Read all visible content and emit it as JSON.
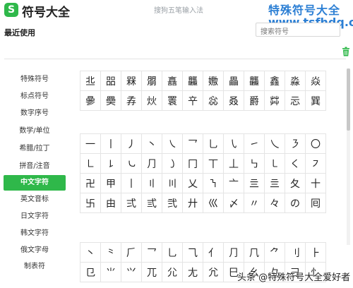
{
  "app": {
    "title": "符号大全",
    "ime_hint": "搜狗五笔输入法",
    "watermark_top": "特殊符号大全",
    "watermark_url": "www.tsfhdq.cn",
    "watermark_bottom": "头条 @特殊符号大全爱好者"
  },
  "recent": {
    "label": "最近使用"
  },
  "search": {
    "placeholder": "搜索符号"
  },
  "sidebar": {
    "items": [
      {
        "label": "特殊符号"
      },
      {
        "label": "标点符号"
      },
      {
        "label": "数字序号"
      },
      {
        "label": "数学/单位"
      },
      {
        "label": "希腊/拉丁"
      },
      {
        "label": "拼音/注音"
      },
      {
        "label": "中文字符"
      },
      {
        "label": "英文音标"
      },
      {
        "label": "日文字符"
      },
      {
        "label": "韩文字符"
      },
      {
        "label": "俄文字母"
      },
      {
        "label": "制表符"
      }
    ],
    "active_index": 6
  },
  "colors": {
    "accent": "#2fb84a",
    "watermark": "#2c7fd4"
  },
  "grid1": [
    [
      "丠",
      "㗊",
      "槑",
      "朤",
      "譶",
      "龘",
      "嫐",
      "畾",
      "龘",
      "鑫",
      "淼",
      "焱"
    ],
    [
      "曑",
      "奰",
      "孨",
      "炏",
      "瞏",
      "䇂",
      "惢",
      "叒",
      "爵",
      "茻",
      "忈",
      "巽"
    ]
  ],
  "grid2": [
    [
      "一",
      "丨",
      "丿",
      "丶",
      "㇏",
      "乛",
      "乚",
      "㇂",
      "㇀",
      "乀",
      "㇋",
      "〇"
    ],
    [
      "㇗",
      "㇙",
      "㇃",
      "⺆",
      "㇁",
      "冂",
      "丅",
      "丄",
      "㇉",
      "㇄",
      "く",
      "㇇"
    ],
    [
      "卍",
      "甲",
      "丨",
      "〢",
      "〣",
      "乂",
      "㇎",
      "亠",
      "亖",
      "亖",
      "夂",
      "十"
    ],
    [
      "卐",
      "由",
      "弍",
      "弎",
      "弐",
      "廾",
      "巛",
      "〆",
      "〃",
      "々",
      "の",
      "囘"
    ]
  ],
  "grid3": [
    [
      "丶",
      "⺀",
      "⺁",
      "⺂",
      "⺃",
      "⺄",
      "⺅",
      "⺆",
      "⺇",
      "⺈",
      "⺉",
      "⺊"
    ],
    [
      "⺋",
      "⺌",
      "⺍",
      "⺎",
      "⺏",
      "⺐",
      "⺑",
      "⺒",
      "⺓",
      "⺔",
      "⺕",
      "⺖"
    ]
  ]
}
